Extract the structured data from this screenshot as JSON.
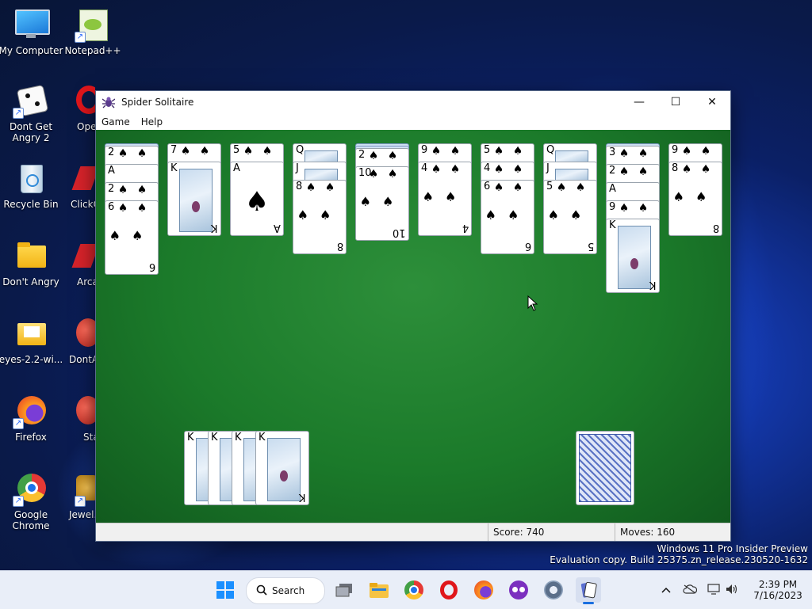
{
  "desktop": {
    "icons": [
      {
        "label": "My Computer",
        "icon": "monitor-icon"
      },
      {
        "label": "Notepad++",
        "icon": "notepad-icon"
      },
      {
        "label": "Dont Get Angry 2",
        "icon": "dice-icon"
      },
      {
        "label": "Opera Browser",
        "icon": "opera-icon"
      },
      {
        "label": "Recycle Bin",
        "icon": "recycle-bin-icon"
      },
      {
        "label": "ClickOnce",
        "icon": "app-icon"
      },
      {
        "label": "Don't Angry",
        "icon": "folder-icon"
      },
      {
        "label": "Arcade",
        "icon": "app-icon"
      },
      {
        "label": "eyes-2.2-wi...",
        "icon": "folder-icon"
      },
      {
        "label": "DontAngry",
        "icon": "app-icon"
      },
      {
        "label": "Firefox",
        "icon": "firefox-icon"
      },
      {
        "label": "Start",
        "icon": "app-icon"
      },
      {
        "label": "Google Chrome",
        "icon": "chrome-icon"
      },
      {
        "label": "Jewel...",
        "icon": "jewel-icon"
      }
    ]
  },
  "window": {
    "title": "Spider Solitaire",
    "menu": [
      "Game",
      "Help"
    ],
    "controls": {
      "minimize": "—",
      "maximize": "☐",
      "close": "✕"
    }
  },
  "tableau": [
    [
      "2",
      "A",
      "2",
      "6"
    ],
    [
      "7",
      "K"
    ],
    [
      "5",
      "A"
    ],
    [
      "Q",
      "J",
      "8"
    ],
    [
      "2",
      "10"
    ],
    [
      "9",
      "4"
    ],
    [
      "5",
      "4",
      "6"
    ],
    [
      "Q",
      "J",
      "5"
    ],
    [
      "3",
      "2",
      "A",
      "9",
      "K"
    ],
    [
      "9",
      "8"
    ]
  ],
  "completed_count": 4,
  "completed_top": "K",
  "suit_symbol": "♠",
  "status": {
    "score": "Score: 740",
    "moves": "Moves:  160"
  },
  "watermark": {
    "line1": "Windows 11 Pro Insider Preview",
    "line2": "Evaluation copy. Build 25375.zn_release.230520-1632"
  },
  "taskbar": {
    "search_label": "Search",
    "time": "2:39 PM",
    "date": "7/16/2023"
  }
}
